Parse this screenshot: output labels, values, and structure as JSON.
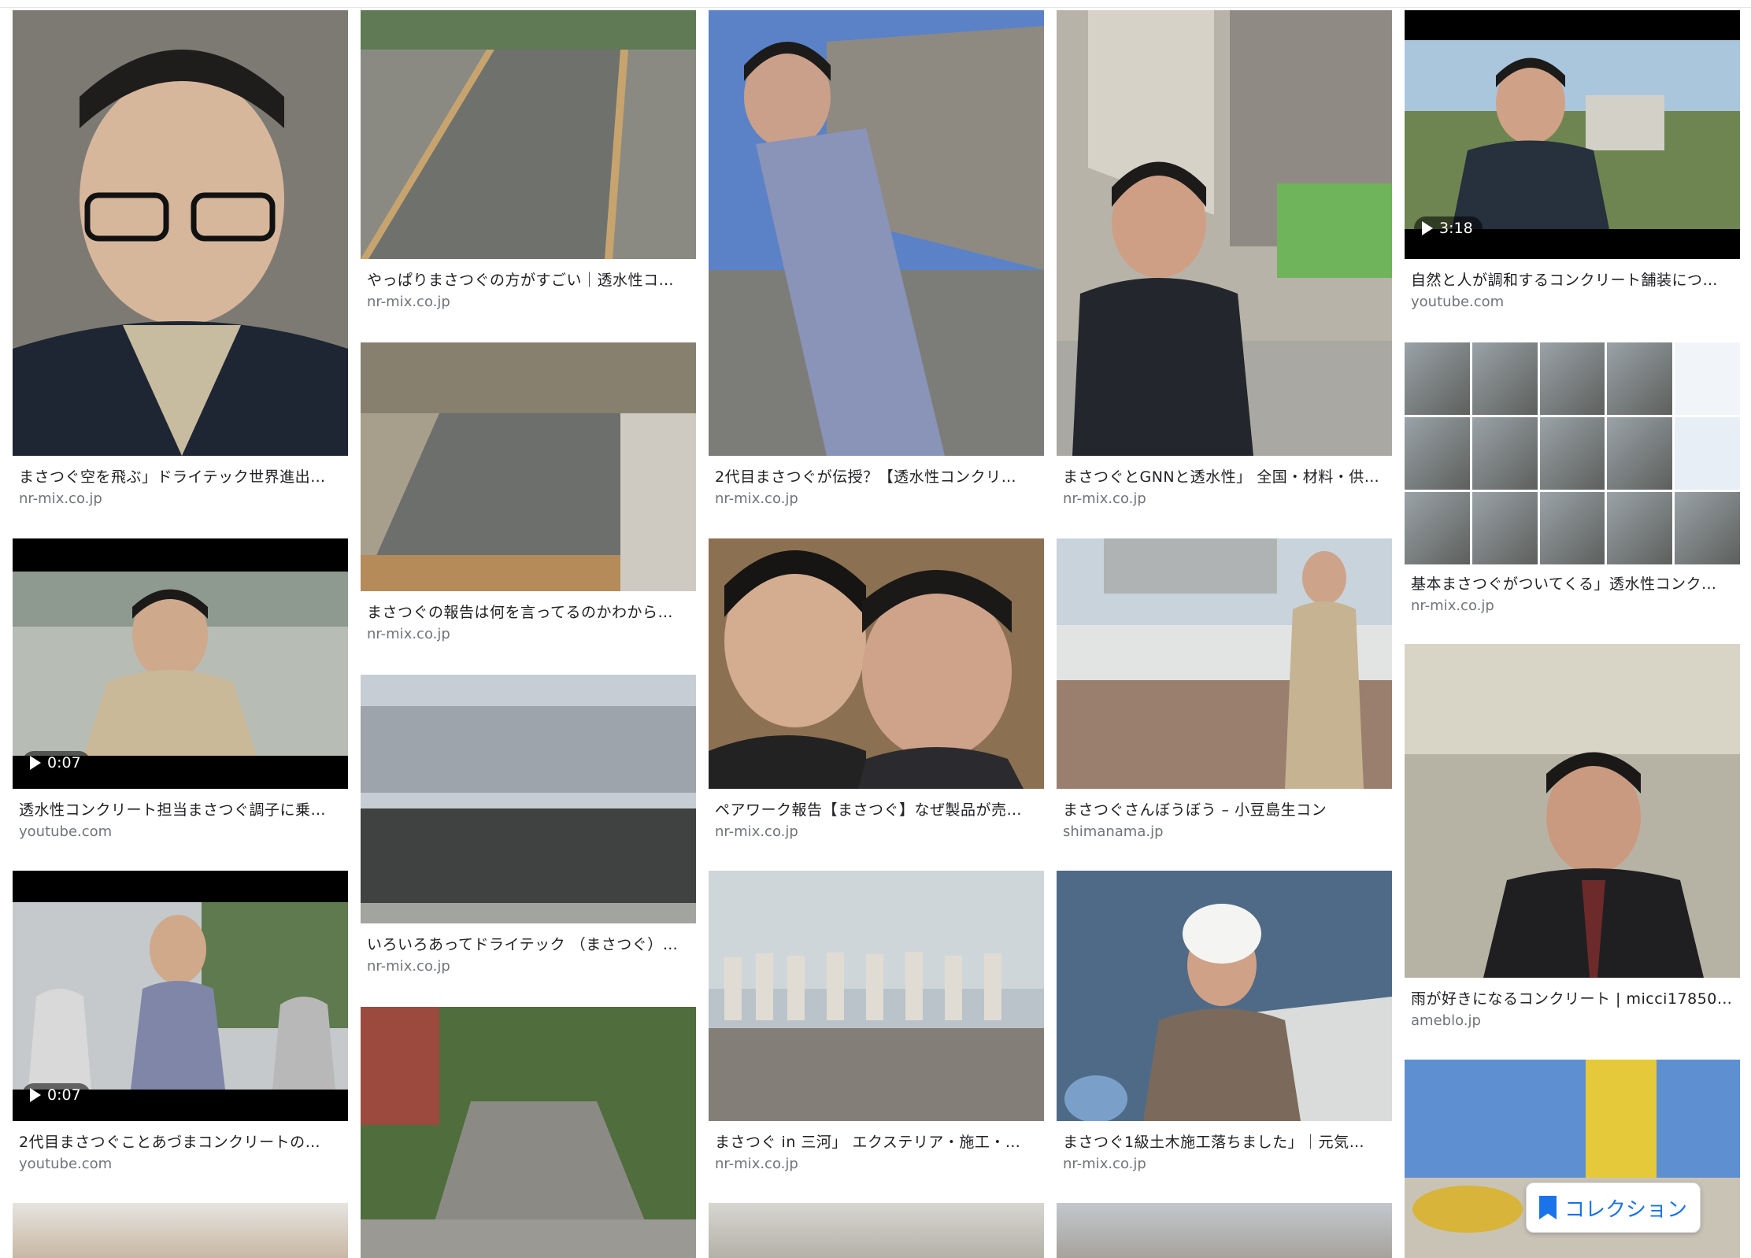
{
  "results": [
    {
      "id": "c1-1",
      "title": "まさつぐ空を飛ぶ」ドライテック世界進出…",
      "source": "nr-mix.co.jp",
      "duration": ""
    },
    {
      "id": "c1-2",
      "title": "透水性コンクリート担当まさつぐ調子に乗…",
      "source": "youtube.com",
      "duration": "0:07"
    },
    {
      "id": "c1-3",
      "title": "2代目まさつぐことあづまコンクリートの…",
      "source": "youtube.com",
      "duration": "0:07"
    },
    {
      "id": "c2-1",
      "title": "やっぱりまさつぐの方がすごい｜透水性コ…",
      "source": "nr-mix.co.jp",
      "duration": ""
    },
    {
      "id": "c2-2",
      "title": "まさつぐの報告は何を言ってるのかわから…",
      "source": "nr-mix.co.jp",
      "duration": ""
    },
    {
      "id": "c2-3",
      "title": "いろいろあってドライテック （まさつぐ）…",
      "source": "nr-mix.co.jp",
      "duration": ""
    },
    {
      "id": "c3-1",
      "title": "2代目まさつぐが伝授？【透水性コンクリ…",
      "source": "nr-mix.co.jp",
      "duration": ""
    },
    {
      "id": "c3-2",
      "title": "ペアワーク報告【まさつぐ】なぜ製品が売…",
      "source": "nr-mix.co.jp",
      "duration": ""
    },
    {
      "id": "c3-3",
      "title": "まさつぐ in 三河」 エクステリア・施工・…",
      "source": "nr-mix.co.jp",
      "duration": ""
    },
    {
      "id": "c4-1",
      "title": "まさつぐとGNNと透水性」 全国・材料・供…",
      "source": "nr-mix.co.jp",
      "duration": ""
    },
    {
      "id": "c4-2",
      "title": "まさつぐさんぼうぼう – 小豆島生コン",
      "source": "shimanama.jp",
      "duration": ""
    },
    {
      "id": "c4-3",
      "title": "まさつぐ1級土木施工落ちました」｜元気…",
      "source": "nr-mix.co.jp",
      "duration": ""
    },
    {
      "id": "c5-1",
      "title": "自然と人が調和するコンクリート舗装につ…",
      "source": "youtube.com",
      "duration": "3:18"
    },
    {
      "id": "c5-2",
      "title": "基本まさつぐがついてくる」透水性コンク…",
      "source": "nr-mix.co.jp",
      "duration": ""
    },
    {
      "id": "c5-3",
      "title": "雨が好きになるコンクリート | micci17850…",
      "source": "ameblo.jp",
      "duration": ""
    }
  ],
  "collection_button": {
    "label": "コレクション"
  },
  "colors": {
    "accent": "#1a73e8",
    "title": "#202124",
    "source": "#70757a"
  }
}
